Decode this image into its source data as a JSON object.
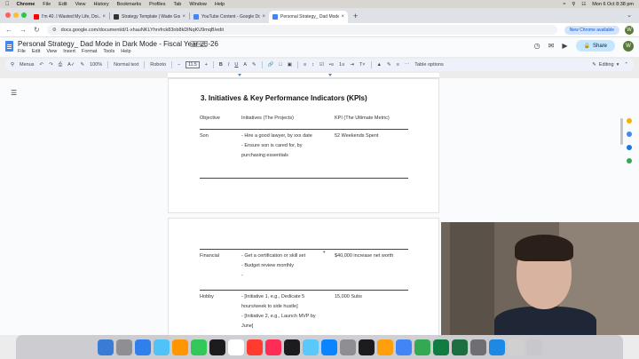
{
  "menubar": {
    "app": "Chrome",
    "items": [
      "File",
      "Edit",
      "View",
      "History",
      "Bookmarks",
      "Profiles",
      "Tab",
      "Window",
      "Help"
    ],
    "clock": "Mon 6 Oct 8:38 pm"
  },
  "tabs": [
    {
      "title": "I'm 40. I Wasted My Life, Doi...",
      "favicon_color": "#ff0000"
    },
    {
      "title": "Strategy Template | Wade Gor...",
      "favicon_color": "#333333"
    },
    {
      "title": "YouTube Content - Google Do...",
      "favicon_color": "#4285f4"
    },
    {
      "title": "Personal Strategy_ Dad Mode...",
      "favicon_color": "#4285f4",
      "active": true
    }
  ],
  "address": {
    "url": "docs.google.com/document/d/1-xhauNKLYhrvfrck83nb8kDlNqKU9mqB/edit",
    "new_chrome": "New Chrome available",
    "avatar": "W"
  },
  "doc": {
    "title": "Personal Strategy_ Dad Mode in Dark Mode - Fiscal Year 25-26",
    "badge": ".DOCX",
    "menu": [
      "File",
      "Edit",
      "View",
      "Insert",
      "Format",
      "Tools",
      "Help"
    ],
    "share": "Share",
    "avatar": "W"
  },
  "toolbar": {
    "menus": "Menus",
    "zoom": "100%",
    "style": "Normal text",
    "font": "Roboto",
    "font_size": "11.5",
    "table_options": "Table options",
    "editing": "Editing"
  },
  "content": {
    "heading": "3. Initiatives & Key Performance Indicators (KPIs)",
    "headers": {
      "objective": "Objective",
      "initiatives": "Initiatives (The Projects)",
      "kpi": "KPI (The Ultimate Metric)"
    },
    "son": {
      "objective": "Son",
      "line1": "- Hire a good lawyer, by xxx date",
      "line2": "- Ensure son is cared for, by",
      "line3": "purchasing essentials",
      "kpi": "52 Weekends Spent"
    },
    "financial": {
      "objective": "Financial",
      "line1": "- Get a certification or skill set",
      "line2": "- Budget review monthly",
      "line3": "-",
      "kpi": "$40,000 increase net worth"
    },
    "hobby": {
      "objective": "Hobby",
      "line1": "- [Initiative 1, e.g., Dedicate 5",
      "line2": "hours/week to side hustle]",
      "line3": "- [Initiative 2, e.g., Launch MVP by",
      "line4": "June]",
      "kpi": "15,000 Subs"
    }
  },
  "dock_colors": [
    "#3a7bd5",
    "#8e8e93",
    "#2f80ed",
    "#4fc3f7",
    "#ff9500",
    "#34c759",
    "#1c1c1e",
    "#ffffff",
    "#ff3b30",
    "#ff2d55",
    "#1c1c1e",
    "#5ac8fa",
    "#0a84ff",
    "#8e8e93",
    "#1c1c1e",
    "#ff9f0a",
    "#4285f4",
    "#34a853",
    "#107c41",
    "#1d6f42",
    "#6e6e73",
    "#1e88e5",
    "#d0d0d0",
    "#c7c7cc"
  ]
}
